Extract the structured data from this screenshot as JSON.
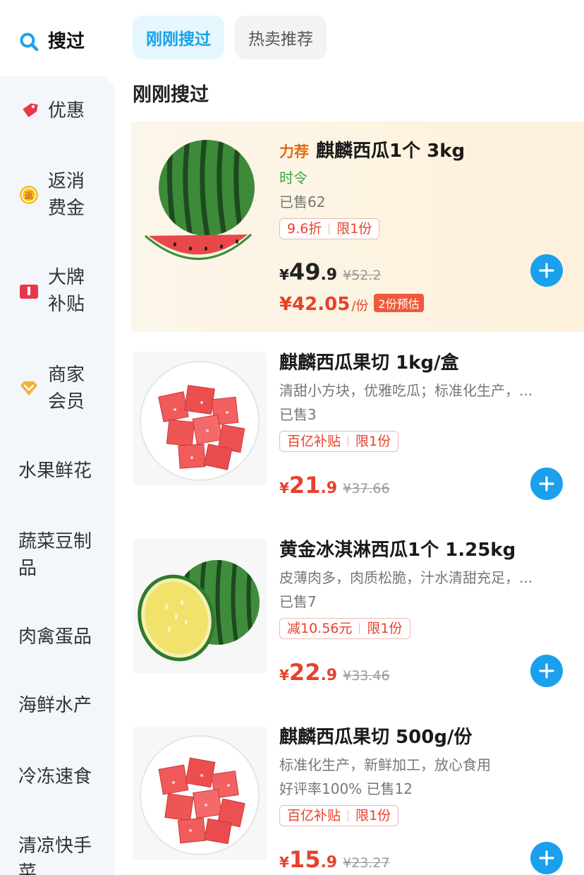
{
  "sidebar": {
    "search": {
      "label": "搜过",
      "icon": "search-icon"
    },
    "items": [
      {
        "label": "优惠",
        "icon": "coupon-icon"
      },
      {
        "label": "返消费金",
        "line1": "返消",
        "line2": "费金",
        "icon": "cashback-icon"
      },
      {
        "label": "大牌补贴",
        "line1": "大牌",
        "line2": "补贴",
        "icon": "brand-subsidy-icon"
      },
      {
        "label": "商家会员",
        "line1": "商家",
        "line2": "会员",
        "icon": "member-icon"
      },
      {
        "label": "水果鲜花"
      },
      {
        "label": "蔬菜豆制品",
        "line1": "蔬菜豆制",
        "line2": "品"
      },
      {
        "label": "肉禽蛋品"
      },
      {
        "label": "海鲜水产"
      },
      {
        "label": "冷冻速食"
      },
      {
        "label": "清凉快手菜",
        "line1": "清凉快手",
        "line2": "菜"
      }
    ]
  },
  "tabs": [
    {
      "label": "刚刚搜过",
      "active": true
    },
    {
      "label": "热卖推荐",
      "active": false
    }
  ],
  "section_title": "刚刚搜过",
  "products": [
    {
      "rec_tag": "力荐",
      "title": "麒麟西瓜1个 3kg",
      "season": "时令",
      "sold": "已售62",
      "tags": [
        "9.6折",
        "限1份"
      ],
      "currency": "¥",
      "price_int": "49",
      "price_dec": ".9",
      "orig_price": "¥52.2",
      "est_price": "¥42.05",
      "est_unit": "/份",
      "est_badge": "2份预估"
    },
    {
      "title": "麒麟西瓜果切 1kg/盒",
      "desc": "清甜小方块，优雅吃瓜；标准化生产，...",
      "sold": "已售3",
      "tags": [
        "百亿补贴",
        "限1份"
      ],
      "currency": "¥",
      "price_int": "21",
      "price_dec": ".9",
      "orig_price": "¥37.66"
    },
    {
      "title": "黄金冰淇淋西瓜1个 1.25kg",
      "desc": "皮薄肉多，肉质松脆，汁水清甜充足，...",
      "sold": "已售7",
      "tags": [
        "减10.56元",
        "限1份"
      ],
      "currency": "¥",
      "price_int": "22",
      "price_dec": ".9",
      "orig_price": "¥33.46"
    },
    {
      "title": "麒麟西瓜果切 500g/份",
      "desc": "标准化生产，新鲜加工，放心食用",
      "sold": "好评率100%  已售12",
      "tags": [
        "百亿补贴",
        "限1份"
      ],
      "currency": "¥",
      "price_int": "15",
      "price_dec": ".9",
      "orig_price": "¥23.27"
    }
  ],
  "colors": {
    "accent_blue": "#1aa0ec",
    "price_red": "#e8412c",
    "sidebar_bg": "#f3f6fa",
    "highlight_bg": "#fdf3e0"
  }
}
